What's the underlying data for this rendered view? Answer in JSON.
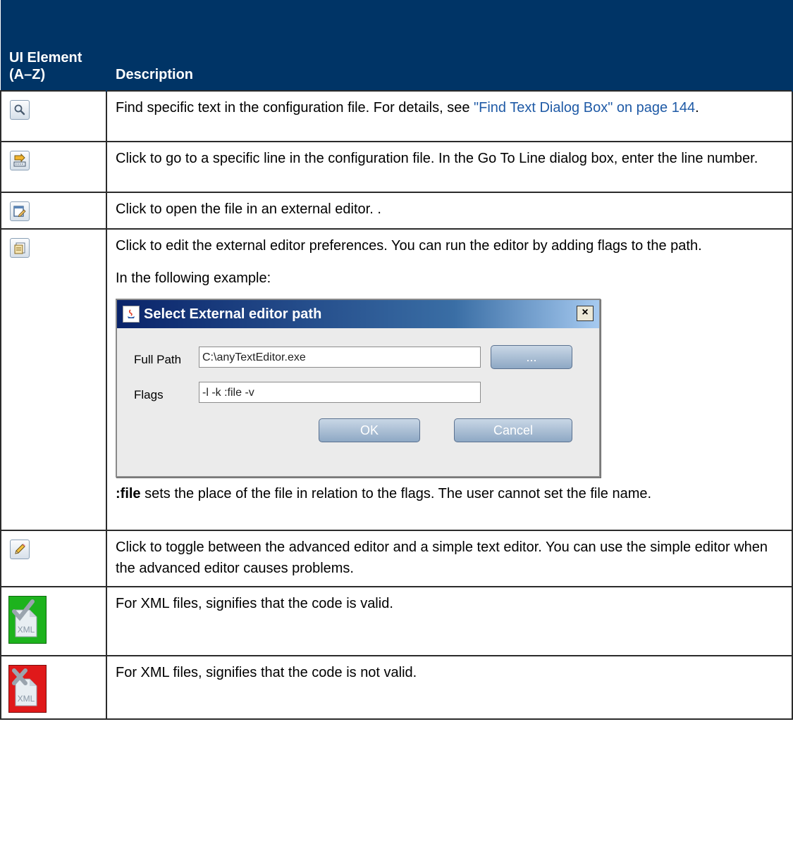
{
  "header": {
    "col1_label": "UI Element (A–Z)",
    "col2_label": "Description"
  },
  "rows": [
    {
      "icon": "find-icon",
      "desc_before_link": "Find specific text in the configuration file. For details, see ",
      "link": "\"Find Text Dialog Box\" on page 144",
      "desc_after_link": "."
    },
    {
      "icon": "go-to-line-icon",
      "desc": "Click to go to a specific line in the configuration file. In the Go To Line dialog box, enter the line number."
    },
    {
      "icon": "external-editor-icon",
      "desc": "Click to open the file in an external editor. ."
    },
    {
      "icon": "editor-preferences-icon",
      "desc": "Click to edit the external editor preferences. You can run the editor by adding flags to the path.",
      "example_intro": "In the following example:",
      "dialog": {
        "title": "Select External editor path",
        "close_glyph": "×",
        "full_path_label": "Full Path",
        "full_path_value": "C:\\anyTextEditor.exe",
        "browse_label": "...",
        "flags_label": "Flags",
        "flags_value": "-l -k :file -v",
        "ok_label": "OK",
        "cancel_label": "Cancel"
      },
      "note_bold": ":file",
      "note_rest": " sets the place of the file in relation to the flags. The user cannot set the file name."
    },
    {
      "icon": "pencil-toggle-icon",
      "desc": "Click to toggle between the advanced editor and a simple text editor. You can use the simple editor when the advanced editor causes problems."
    },
    {
      "icon": "xml-valid-icon",
      "icon_text": "XML",
      "desc": "For XML files, signifies that the code is valid."
    },
    {
      "icon": "xml-invalid-icon",
      "icon_text": "XML",
      "desc": "For XML files, signifies that the code is not valid."
    }
  ],
  "colors": {
    "header_bg": "#003466",
    "link": "#1f5aa6",
    "valid_green": "#1db31d",
    "invalid_red": "#e0191a"
  }
}
